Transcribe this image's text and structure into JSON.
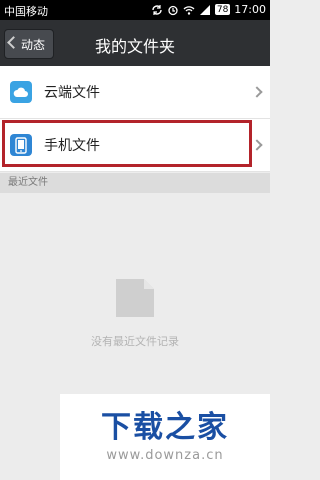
{
  "status_bar": {
    "carrier": "中国移动",
    "battery": "78",
    "time": "17:00"
  },
  "header": {
    "back_label": "动态",
    "title": "我的文件夹"
  },
  "list": {
    "items": [
      {
        "label": "云端文件",
        "icon": "cloud-icon"
      },
      {
        "label": "手机文件",
        "icon": "phone-icon"
      }
    ]
  },
  "section": {
    "recent_label": "最近文件"
  },
  "empty_state": {
    "icon": "document-icon",
    "text": "没有最近文件记录"
  },
  "watermark": {
    "logo_text": "下载之家",
    "url": "www.downza.cn"
  },
  "colors": {
    "header_bg": "#2e3033",
    "highlight_border": "#b3232a",
    "cloud_icon": "#3aa3e3",
    "phone_icon": "#2f86d4",
    "watermark_blue": "#1a4fa3"
  }
}
